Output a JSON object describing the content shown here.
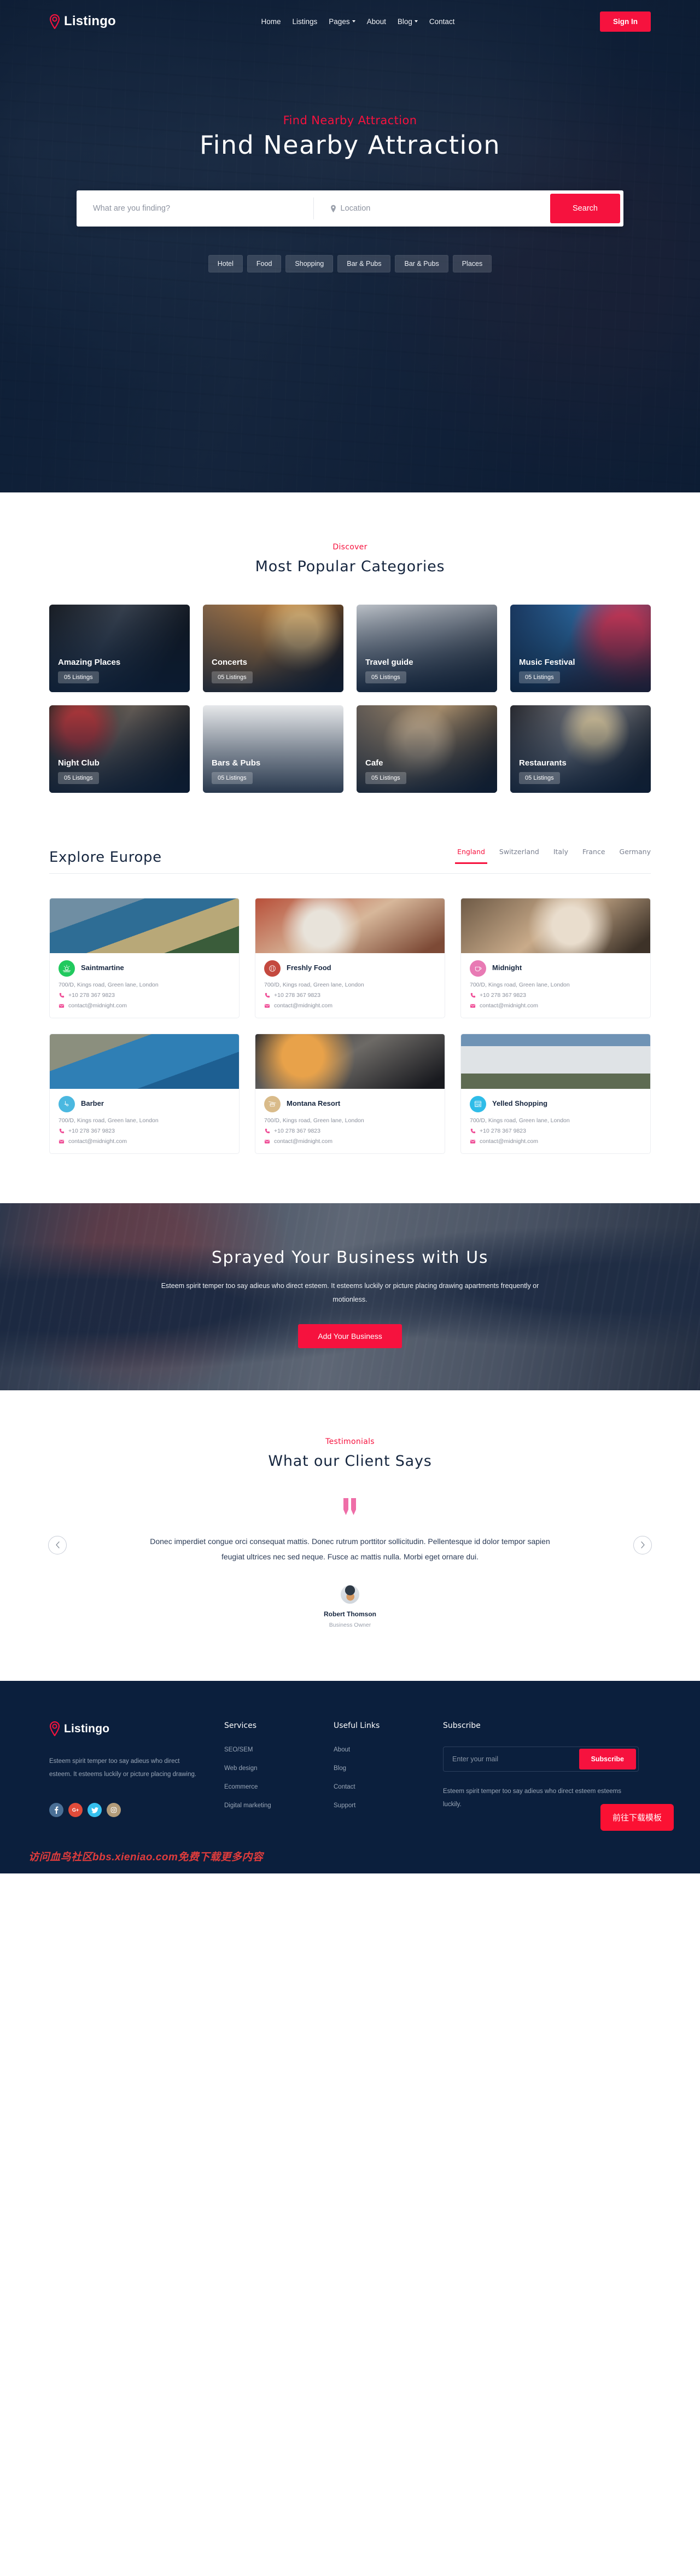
{
  "brand": {
    "name": "Listingo",
    "accent": "#f6123e",
    "dark": "#0b1f3d"
  },
  "header": {
    "nav": [
      {
        "label": "Home",
        "caret": false
      },
      {
        "label": "Listings",
        "caret": false
      },
      {
        "label": "Pages",
        "caret": true
      },
      {
        "label": "About",
        "caret": false
      },
      {
        "label": "Blog",
        "caret": true
      },
      {
        "label": "Contact",
        "caret": false
      }
    ],
    "signin_label": "Sign In"
  },
  "hero": {
    "eyebrow": "Find Nearby Attraction",
    "title": "Find Nearby Attraction",
    "search": {
      "keyword_placeholder": "What are you finding?",
      "keyword_value": "",
      "location_placeholder": "Location",
      "location_value": "",
      "button_label": "Search"
    },
    "chips": [
      "Hotel",
      "Food",
      "Shopping",
      "Bar & Pubs",
      "Bar & Pubs",
      "Places"
    ]
  },
  "categories": {
    "eyebrow": "Discover",
    "title": "Most Popular Categories",
    "items": [
      {
        "name": "Amazing Places",
        "count": "05 Listings"
      },
      {
        "name": "Concerts",
        "count": "05 Listings"
      },
      {
        "name": "Travel guide",
        "count": "05 Listings"
      },
      {
        "name": "Music Festival",
        "count": "05 Listings"
      },
      {
        "name": "Night Club",
        "count": "05 Listings"
      },
      {
        "name": "Bars & Pubs",
        "count": "05 Listings"
      },
      {
        "name": "Cafe",
        "count": "05 Listings"
      },
      {
        "name": "Restaurants",
        "count": "05 Listings"
      }
    ]
  },
  "explore": {
    "title": "Explore Europe",
    "tabs": [
      {
        "label": "England",
        "active": true
      },
      {
        "label": "Switzerland",
        "active": false
      },
      {
        "label": "Italy",
        "active": false
      },
      {
        "label": "France",
        "active": false
      },
      {
        "label": "Germany",
        "active": false
      }
    ],
    "listings": [
      {
        "name": "Saintmartine",
        "address": "700/D, Kings road, Green lane, London",
        "phone": "+10 278 367 9823",
        "email": "contact@midnight.com",
        "icon_color": "#21c95e",
        "icon": "sunrise-icon"
      },
      {
        "name": "Freshly Food",
        "address": "700/D, Kings road, Green lane, London",
        "phone": "+10 278 367 9823",
        "email": "contact@midnight.com",
        "icon_color": "#c4493f",
        "icon": "cutlery-icon"
      },
      {
        "name": "Midnight",
        "address": "700/D, Kings road, Green lane, London",
        "phone": "+10 278 367 9823",
        "email": "contact@midnight.com",
        "icon_color": "#e87ab4",
        "icon": "cup-icon"
      },
      {
        "name": "Barber",
        "address": "700/D, Kings road, Green lane, London",
        "phone": "+10 278 367 9823",
        "email": "contact@midnight.com",
        "icon_color": "#4bb8e0",
        "icon": "razor-icon"
      },
      {
        "name": "Montana Resort",
        "address": "700/D, Kings road, Green lane, London",
        "phone": "+10 278 367 9823",
        "email": "contact@midnight.com",
        "icon_color": "#d9bb8a",
        "icon": "cablecar-icon"
      },
      {
        "name": "Yelled Shopping",
        "address": "700/D, Kings road, Green lane, London",
        "phone": "+10 278 367 9823",
        "email": "contact@midnight.com",
        "icon_color": "#2fbce8",
        "icon": "shop-icon"
      }
    ]
  },
  "cta": {
    "title": "Sprayed Your Business with Us",
    "text": "Esteem spirit temper too say adieus who direct esteem. It esteems luckily or picture placing drawing apartments frequently or motionless.",
    "button_label": "Add Your Business"
  },
  "testimonials": {
    "eyebrow": "Testimonials",
    "title": "What our Client Says",
    "quote": "Donec imperdiet congue orci consequat mattis. Donec rutrum porttitor sollicitudin. Pellentesque id dolor tempor sapien feugiat ultrices nec sed neque. Fusce ac mattis nulla. Morbi eget ornare dui.",
    "author_name": "Robert Thomson",
    "author_role": "Business Owner"
  },
  "footer": {
    "about": "Esteem spirit temper too say adieus who direct esteem. It esteems luckily or picture placing drawing.",
    "socials": [
      {
        "name": "facebook-icon",
        "glyph": "f",
        "color": "#4a6f96"
      },
      {
        "name": "google-plus-icon",
        "glyph": "G+",
        "color": "#e04b3a"
      },
      {
        "name": "twitter-icon",
        "glyph": "t",
        "color": "#35c0ef"
      },
      {
        "name": "instagram-icon",
        "glyph": "o",
        "color": "#b29b79"
      }
    ],
    "services": {
      "title": "Services",
      "links": [
        "SEO/SEM",
        "Web design",
        "Ecommerce",
        "Digital marketing"
      ]
    },
    "useful": {
      "title": "Useful Links",
      "links": [
        "About",
        "Blog",
        "Contact",
        "Support"
      ]
    },
    "subscribe": {
      "title": "Subscribe",
      "placeholder": "Enter your mail",
      "value": "",
      "button_label": "Subscribe",
      "note": "Esteem spirit temper too say adieus who direct esteem esteems luckily."
    },
    "download_button": "前往下载模板",
    "watermark": "访问血鸟社区bbs.xieniao.com免费下载更多内容"
  }
}
